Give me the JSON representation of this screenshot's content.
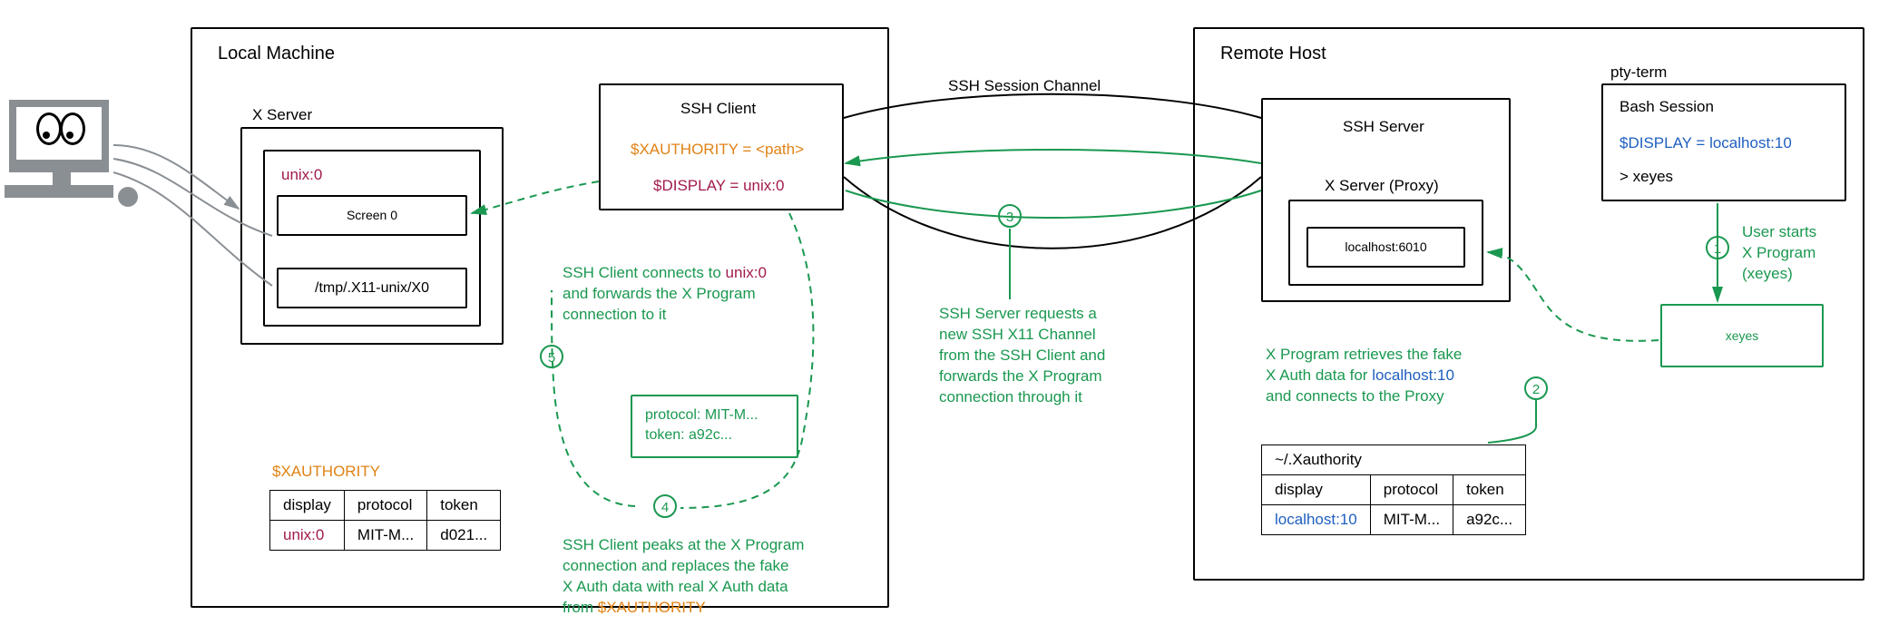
{
  "local": {
    "title": "Local Machine",
    "xserver": {
      "title": "X Server",
      "display": "unix:0",
      "screen": "Screen 0",
      "socket": "/tmp/.X11-unix/X0"
    },
    "xauth": {
      "title": "$XAUTHORITY",
      "headers": [
        "display",
        "protocol",
        "token"
      ],
      "row": {
        "display": "unix:0",
        "protocol": "MIT-M...",
        "token": "d021..."
      }
    },
    "sshclient": {
      "title": "SSH Client",
      "xauthority": "$XAUTHORITY = <path>",
      "display": "$DISPLAY = unix:0"
    }
  },
  "channel_label": "SSH Session Channel",
  "remote": {
    "title": "Remote Host",
    "sshserver": {
      "title": "SSH Server",
      "proxy_title": "X Server (Proxy)",
      "proxy_listen": "localhost:6010"
    },
    "xauth": {
      "title": "~/.Xauthority",
      "headers": [
        "display",
        "protocol",
        "token"
      ],
      "row": {
        "display": "localhost:10",
        "protocol": "MIT-M...",
        "token": "a92c..."
      }
    },
    "pty": {
      "title": "pty-term",
      "bash_title": "Bash Session",
      "display": "$DISPLAY = localhost:10",
      "prompt": "> xeyes",
      "program": "xeyes"
    }
  },
  "packet": {
    "line1": "protocol: MIT-M...",
    "line2": "token: a92c..."
  },
  "steps": {
    "s1": {
      "num": "1",
      "text_l1": "User starts",
      "text_l2": "X Program",
      "text_l3": "(xeyes)"
    },
    "s2": {
      "num": "2",
      "text_l1": "X Program retrieves the fake",
      "text_l2_a": "X Auth data for ",
      "text_l2_b": "localhost:10",
      "text_l3": "and connects to the Proxy"
    },
    "s3": {
      "num": "3",
      "text_l1": "SSH Server requests a",
      "text_l2": "new SSH X11 Channel",
      "text_l3": "from the SSH Client and",
      "text_l4": "forwards the X Program",
      "text_l5": "connection through it"
    },
    "s4": {
      "num": "4",
      "text_l1": "SSH Client peaks at the X Program",
      "text_l2": "connection and replaces the fake",
      "text_l3": "X Auth data with real X Auth data",
      "text_l4_a": "from ",
      "text_l4_b": "$XAUTHORITY"
    },
    "s5": {
      "num": "5",
      "text_l1_a": "SSH Client connects to ",
      "text_l1_b": "unix:0",
      "text_l2": "and forwards the X Program",
      "text_l3": "connection to it"
    }
  }
}
